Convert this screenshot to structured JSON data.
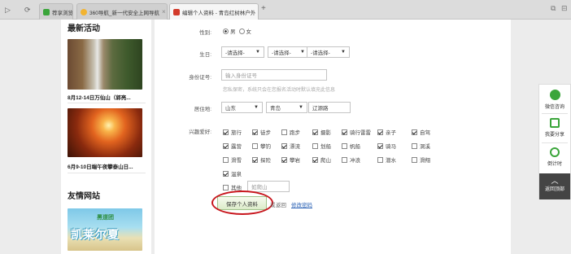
{
  "browser": {
    "nav": {
      "forward": "▷",
      "refresh": "⟳"
    },
    "tabs": [
      {
        "label": "荐享浏览",
        "color": "#3aa53a"
      },
      {
        "label": "360导航_新一代安全上网导航",
        "color": "#f2b431"
      },
      {
        "label": "编辑个人资料 - 青岛红树林户外",
        "color": "#d23a2a",
        "active": true
      }
    ],
    "new_tab": "+",
    "tab_close": "×"
  },
  "sidebar": {
    "latest_title": "最新活动",
    "activities": [
      {
        "caption": "8月12-14日万仙山（郭亮..."
      },
      {
        "caption": "6月9-10日端午夜攀泰山日..."
      }
    ],
    "friends_title": "友情网站",
    "friend_banner": "凯莱尔夏",
    "friend_sub": "黑道团"
  },
  "form": {
    "gender": {
      "label": "性别:",
      "options": [
        "男",
        "女"
      ],
      "selected": "男"
    },
    "birthday": {
      "label": "生日:",
      "selects": [
        "-请选择-",
        "-请选择-",
        "-请选择-"
      ]
    },
    "id_card": {
      "label": "身份证号:",
      "placeholder": "输入身份证号",
      "hint": "您私保密，系统只会在您报名活动时默认填充此信息"
    },
    "residence": {
      "label": "居住地:",
      "province": "山东",
      "city": "青岛",
      "district": "辽源路"
    },
    "hobbies": {
      "label": "兴趣爱好:",
      "items": [
        {
          "name": "旅行",
          "checked": true
        },
        {
          "name": "徒步",
          "checked": true
        },
        {
          "name": "跑步",
          "checked": false
        },
        {
          "name": "摄影",
          "checked": true
        },
        {
          "name": "骑行雷雷",
          "checked": true
        },
        {
          "name": "亲子",
          "checked": true
        },
        {
          "name": "自驾",
          "checked": true
        },
        {
          "name": "露营",
          "checked": true
        },
        {
          "name": "攀钓",
          "checked": false
        },
        {
          "name": "漂流",
          "checked": true
        },
        {
          "name": "划船",
          "checked": false
        },
        {
          "name": "帆船",
          "checked": false
        },
        {
          "name": "骑马",
          "checked": true
        },
        {
          "name": "洞溪",
          "checked": false
        },
        {
          "name": "滑雪",
          "checked": false
        },
        {
          "name": "探险",
          "checked": true
        },
        {
          "name": "攀岩",
          "checked": true
        },
        {
          "name": "爬山",
          "checked": true
        },
        {
          "name": "冲浪",
          "checked": false
        },
        {
          "name": "潜水",
          "checked": false
        },
        {
          "name": "滑翔",
          "checked": false
        },
        {
          "name": "温泉",
          "checked": true
        }
      ],
      "other_label": "其他",
      "other_placeholder": "如爬山"
    },
    "save_button": "保存个人资料",
    "or_text": "或",
    "back_text": "返回",
    "change_password": "修改密码"
  },
  "right_bar": {
    "items": [
      {
        "label": "微信咨询",
        "icon": "wechat-icon",
        "color": "#3aa53a"
      },
      {
        "label": "我要分享",
        "icon": "share-icon",
        "color": "#3aa53a"
      },
      {
        "label": "倒计时",
        "icon": "clock-icon",
        "color": "#3aa53a"
      }
    ],
    "back_top": "返回顶部"
  }
}
